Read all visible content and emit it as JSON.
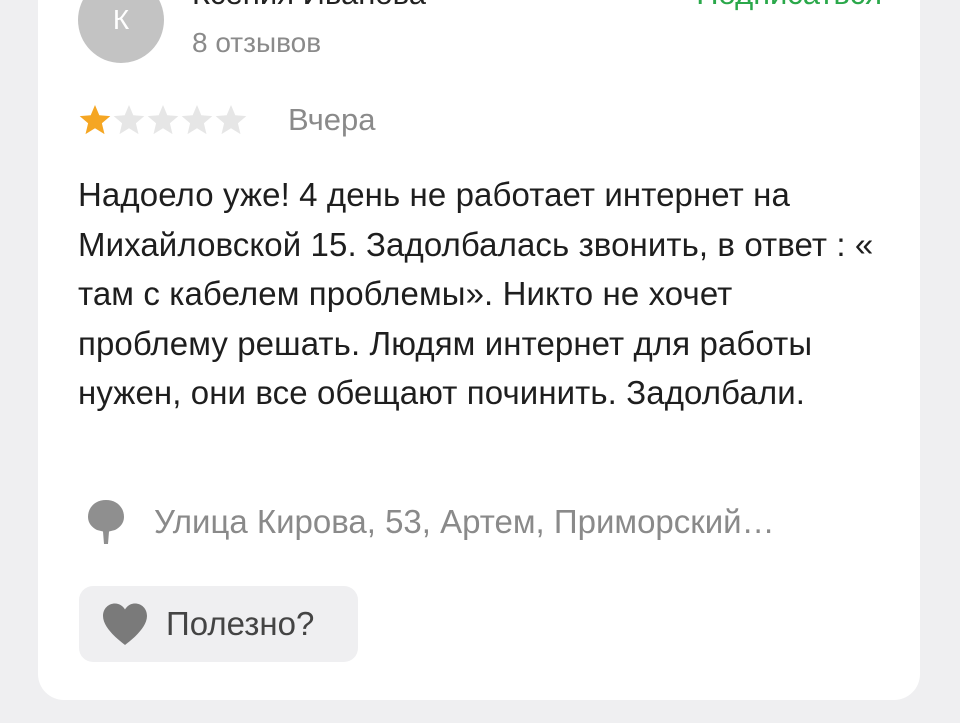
{
  "review": {
    "author": {
      "avatar_letter": "К",
      "name": "Ксения Иванова",
      "review_count": "8 отзывов"
    },
    "subscribe_label": "Подписаться",
    "rating": {
      "value": 1,
      "max": 5,
      "filled_color": "#f5a623",
      "empty_color": "#e6e6e6"
    },
    "date": "Вчера",
    "text": "Надоело уже! 4 день не работает интернет на Михайловской 15. Задолбалась звонить, в ответ : « там с кабелем проблемы». Никто не хочет проблему решать. Людям интернет для работы нужен, они все обещают починить. Задолбали.",
    "address": "Улица Кирова, 53, Артем, Приморский…",
    "helpful_label": "Полезно?"
  },
  "colors": {
    "accent_green": "#2aa84a",
    "background": "#efeff1",
    "card": "#ffffff"
  },
  "icons": {
    "pin": "map-pin-icon",
    "heart": "heart-icon",
    "star": "star-icon"
  }
}
